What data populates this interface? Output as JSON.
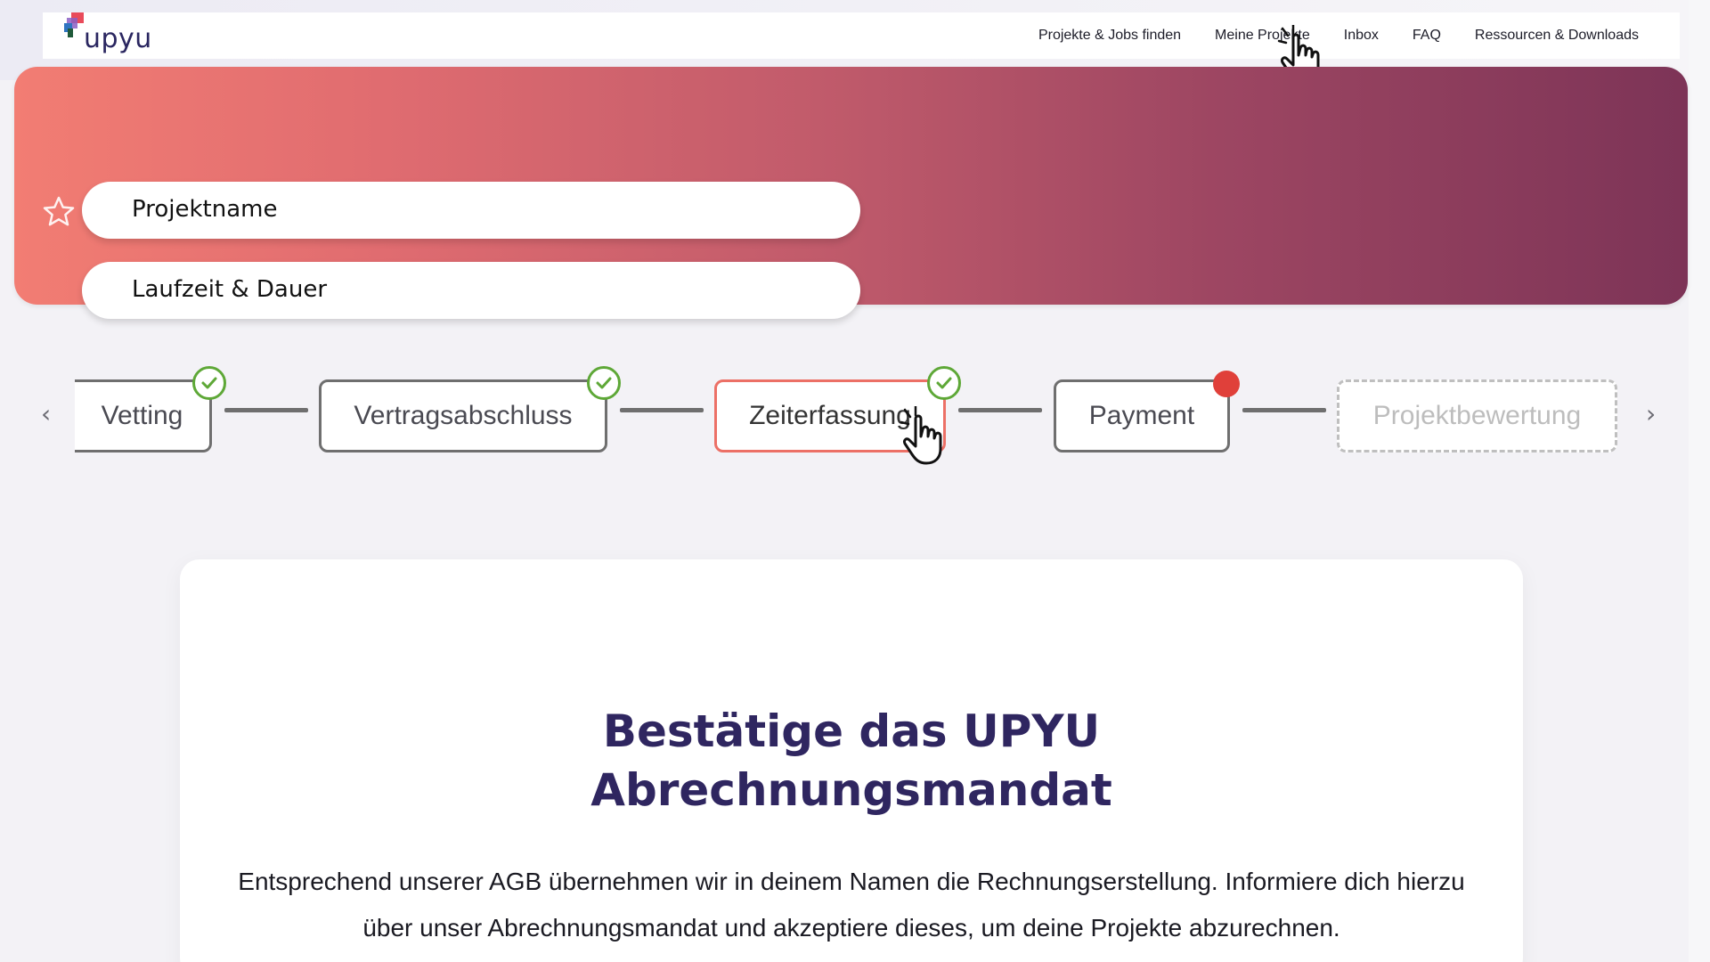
{
  "header": {
    "logo_text": "upyu",
    "nav": [
      "Projekte & Jobs finden",
      "Meine Projekte",
      "Inbox",
      "FAQ",
      "Ressourcen & Downloads"
    ]
  },
  "project": {
    "name_placeholder": "Projektname",
    "duration_placeholder": "Laufzeit & Dauer",
    "favorite_icon": "star-icon"
  },
  "stepper": {
    "steps": [
      {
        "label": "Vetting",
        "status": "completed"
      },
      {
        "label": "Vertragsabschluss",
        "status": "completed"
      },
      {
        "label": "Zeiterfassung",
        "status": "completed"
      },
      {
        "label": "Payment",
        "status": "attention"
      },
      {
        "label": "Projektbewertung",
        "status": "disabled"
      }
    ],
    "prev_icon": "chevron-left-icon",
    "next_icon": "chevron-right-icon"
  },
  "card": {
    "title_line1": "Bestätige das UPYU",
    "title_line2": "Abrechnungsmandat",
    "text": "Entsprechend unserer AGB übernehmen wir in deinem Namen die Rechnungserstellung. Informiere dich hierzu über unser Abrechnungsmandat und akzeptiere dieses, um deine Projekte abzurechnen."
  },
  "colors": {
    "hero_gradient_start": "#f27d73",
    "hero_gradient_end": "#7d3457",
    "check_green": "#5ea837",
    "alert_red": "#e0403a",
    "active_step_border": "#ec7066",
    "title_color": "#2f2660"
  }
}
